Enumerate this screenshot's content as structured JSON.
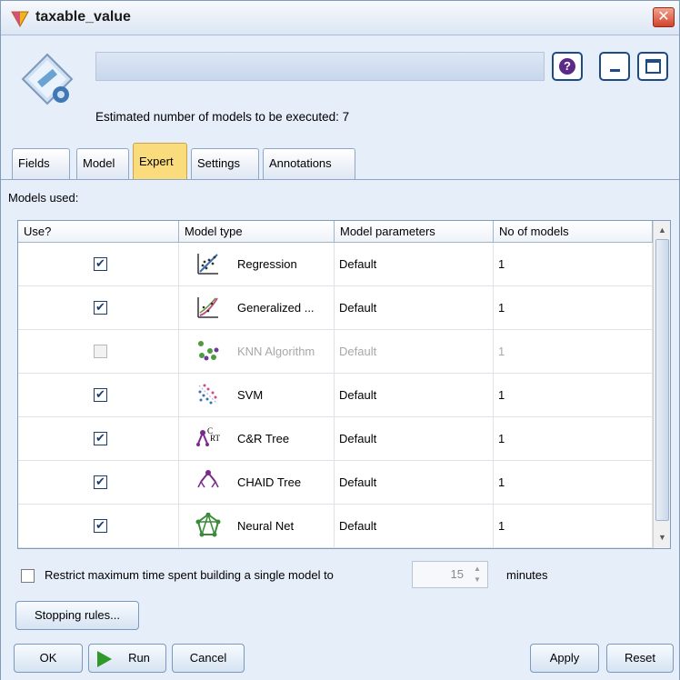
{
  "window": {
    "title": "taxable_value"
  },
  "header": {
    "estimate_text": "Estimated number of models to be executed: 7",
    "help_label": "?"
  },
  "tabs": [
    {
      "label": "Fields"
    },
    {
      "label": "Model"
    },
    {
      "label": "Expert",
      "active": true
    },
    {
      "label": "Settings"
    },
    {
      "label": "Annotations"
    }
  ],
  "content": {
    "models_used_label": "Models used:",
    "table": {
      "columns": [
        "Use?",
        "Model type",
        "Model parameters",
        "No of models"
      ],
      "rows": [
        {
          "use": true,
          "icon": "regression-icon",
          "type": "Regression",
          "params": "Default",
          "count": "1",
          "enabled": true
        },
        {
          "use": true,
          "icon": "glm-icon",
          "type": "Generalized ...",
          "params": "Default",
          "count": "1",
          "enabled": true
        },
        {
          "use": false,
          "icon": "knn-icon",
          "type": "KNN Algorithm",
          "params": "Default",
          "count": "1",
          "enabled": false
        },
        {
          "use": true,
          "icon": "svm-icon",
          "type": "SVM",
          "params": "Default",
          "count": "1",
          "enabled": true
        },
        {
          "use": true,
          "icon": "crt-tree-icon",
          "type": "C&R Tree",
          "params": "Default",
          "count": "1",
          "enabled": true
        },
        {
          "use": true,
          "icon": "chaid-tree-icon",
          "type": "CHAID Tree",
          "params": "Default",
          "count": "1",
          "enabled": true
        },
        {
          "use": true,
          "icon": "neural-net-icon",
          "type": "Neural Net",
          "params": "Default",
          "count": "1",
          "enabled": true
        }
      ]
    },
    "restrict_label": "Restrict maximum time spent building a single model to",
    "restrict_checked": false,
    "minutes_value": "15",
    "minutes_unit": "minutes",
    "stopping_rules_label": "Stopping rules..."
  },
  "footer": {
    "ok_label": "OK",
    "run_label": "Run",
    "cancel_label": "Cancel",
    "apply_label": "Apply",
    "reset_label": "Reset"
  },
  "colors": {
    "active_tab": "#fbdc7c",
    "window_bg": "#e6eefa",
    "close_button": "#d2432b",
    "run_icon": "#2f9a2a"
  }
}
